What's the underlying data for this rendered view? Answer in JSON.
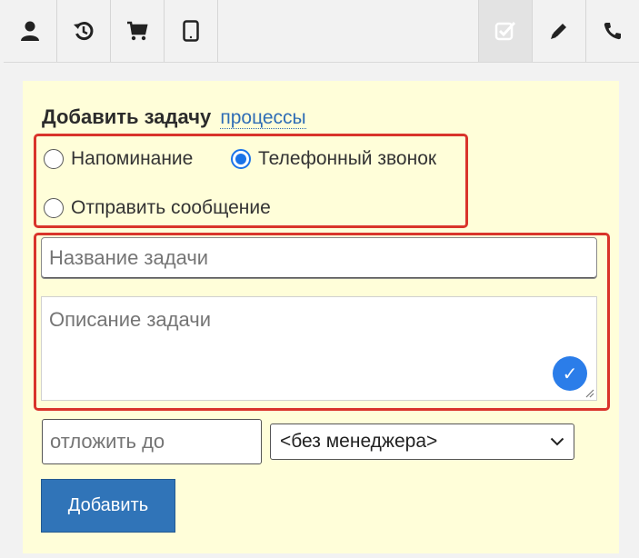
{
  "toolbar": {
    "icons": [
      "user-icon",
      "history-icon",
      "cart-icon",
      "tablet-icon",
      "task-check-icon",
      "pencil-icon",
      "phone-icon"
    ]
  },
  "form": {
    "title": "Добавить задачу",
    "processes_link": "процессы",
    "radios": {
      "reminder": "Напоминание",
      "phone_call": "Телефонный звонок",
      "send_message": "Отправить сообщение",
      "selected": "phone_call"
    },
    "task_name_placeholder": "Название задачи",
    "task_description_placeholder": "Описание задачи",
    "postpone_placeholder": "отложить до",
    "manager_select_value": "<без менеджера>",
    "submit_label": "Добавить"
  },
  "colors": {
    "panel_bg": "#fffed9",
    "highlight_border": "#d9342b",
    "button_bg": "#3074b8",
    "radio_checked": "#1a73e8"
  }
}
